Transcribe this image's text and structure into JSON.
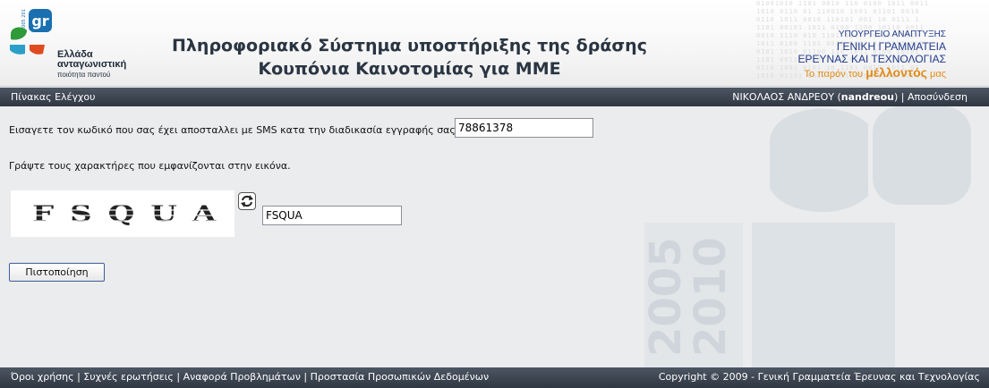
{
  "header": {
    "logo": {
      "line1": "Ελλάδα",
      "line2": "ανταγωνιστική",
      "line3": "ποιότητα παντού",
      "mark_text": "gr",
      "years": "2005 2010"
    },
    "title_line1": "Πληροφοριακό Σύστημα υποστήριξης της δράσης",
    "title_line2": "Κουπόνια Καινοτομίας για ΜΜΕ",
    "ministry": {
      "line1": "ΥΠΟΥΡΓΕΙΟ ΑΝΑΠΤΥΞΗΣ",
      "line2": "ΓΕΝΙΚΗ ΓΡΑΜΜΑΤΕΙΑ",
      "line3": "ΕΡΕΥΝΑΣ ΚΑΙ ΤΕΧΝΟΛΟΓΙΑΣ",
      "slogan_pre": "Το παρόν του",
      "slogan_bold": "μέλλοντός",
      "slogan_post": "μας"
    }
  },
  "navbar": {
    "dashboard_link": "Πίνακας Ελέγχου",
    "user_name": "ΝΙΚΟΛΑΟΣ ΑΝΔΡΕΟΥ",
    "user_id": "nandreou",
    "separator": "|",
    "logout_link": "Αποσύνδεση"
  },
  "form": {
    "sms_prompt": "Εισαγετε τον κωδικό που σας έχει αποσταλλει με SMS κατα την διαδικασία εγγραφής σας.",
    "sms_code_value": "78861378",
    "captcha_prompt": "Γράψτε τους χαρακτήρες που εμφανίζονται στην εικόνα.",
    "captcha_image_text": "FSQUA",
    "captcha_value": "FSQUA",
    "verify_button": "Πιστοποίηση"
  },
  "footer": {
    "links": [
      "Όροι χρήσης",
      "Συχνές ερωτήσεις",
      "Αναφορά Προβλημάτων",
      "Προστασία Προσωπικών Δεδομένων"
    ],
    "link_separator": "|",
    "copyright": "Copyright © 2009 - Γενική Γραμματεία Έρευνας και Τεχνολογίας"
  },
  "colors": {
    "bar_dark": "#2f3742",
    "title_text": "#2a3542",
    "ministry_blue": "#1f3a8a",
    "slogan_orange": "#e08a14",
    "body_bg": "#ebeced"
  }
}
